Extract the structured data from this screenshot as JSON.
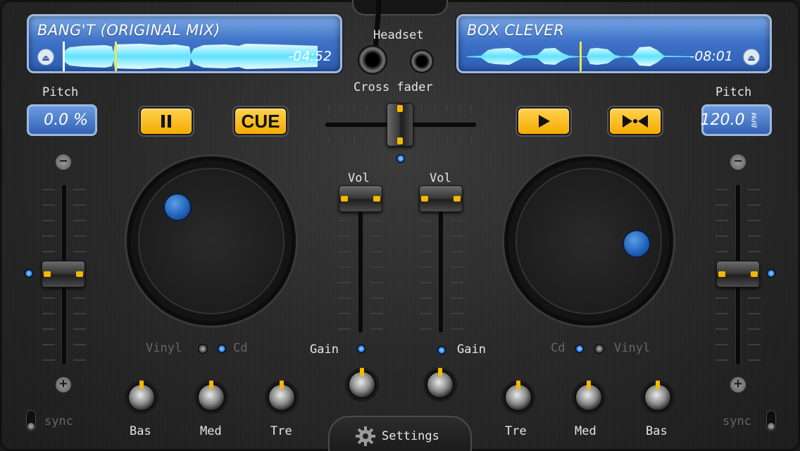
{
  "deck_left": {
    "track_title": "BANG'T (ORIGINAL MIX)",
    "time": "-04:52",
    "pitch_label": "Pitch",
    "pitch_value": "0.0 %",
    "pause_icon": "pause-icon",
    "cue_label": "CUE",
    "mode_vinyl": "Vinyl",
    "mode_cd": "Cd",
    "sync_label": "sync",
    "eq": {
      "bass": "Bas",
      "mid": "Med",
      "treble": "Tre"
    }
  },
  "deck_right": {
    "track_title": "BOX CLEVER",
    "time": "-08:01",
    "pitch_label": "Pitch",
    "pitch_value": "120.0",
    "pitch_unit": "BPM",
    "play_icon": "play-icon",
    "loop_icon": "bowtie-sync-icon",
    "mode_vinyl": "Vinyl",
    "mode_cd": "Cd",
    "sync_label": "sync",
    "eq": {
      "bass": "Bas",
      "mid": "Med",
      "treble": "Tre"
    }
  },
  "mixer": {
    "headset_label": "Headset",
    "crossfader_label": "Cross fader",
    "vol_left_label": "Vol",
    "vol_right_label": "Vol",
    "gain_left_label": "Gain",
    "gain_right_label": "Gain"
  },
  "footer": {
    "settings_label": "Settings",
    "settings_icon": "gear-icon"
  },
  "colors": {
    "accent_yellow": "#f5b800",
    "lcd_blue": "#3f73c7",
    "led_blue": "#1d6fd8"
  }
}
